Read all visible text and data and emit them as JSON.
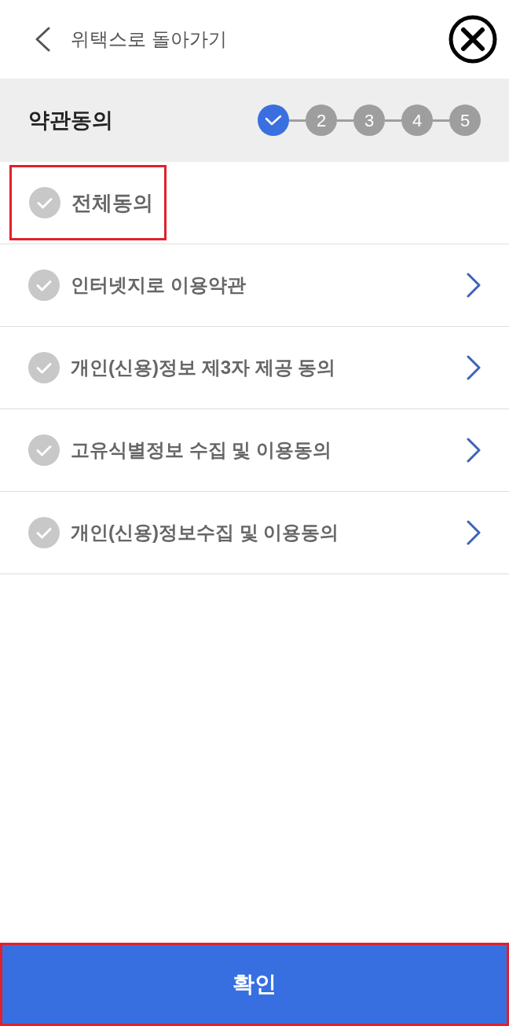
{
  "header": {
    "back_label": "위택스로 돌아가기"
  },
  "progress": {
    "title": "약관동의",
    "steps": [
      {
        "completed": true
      },
      {
        "label": "2",
        "completed": false
      },
      {
        "label": "3",
        "completed": false
      },
      {
        "label": "4",
        "completed": false
      },
      {
        "label": "5",
        "completed": false
      }
    ]
  },
  "agree_all": {
    "label": "전체동의",
    "checked": false,
    "highlighted": true
  },
  "terms": [
    {
      "label": "인터넷지로 이용약관",
      "checked": false
    },
    {
      "label": "개인(신용)정보 제3자 제공 동의",
      "checked": false
    },
    {
      "label": "고유식별정보 수집 및 이용동의",
      "checked": false
    },
    {
      "label": "개인(신용)정보수집 및 이용동의",
      "checked": false
    }
  ],
  "confirm_button": {
    "label": "확인",
    "highlighted": true
  }
}
